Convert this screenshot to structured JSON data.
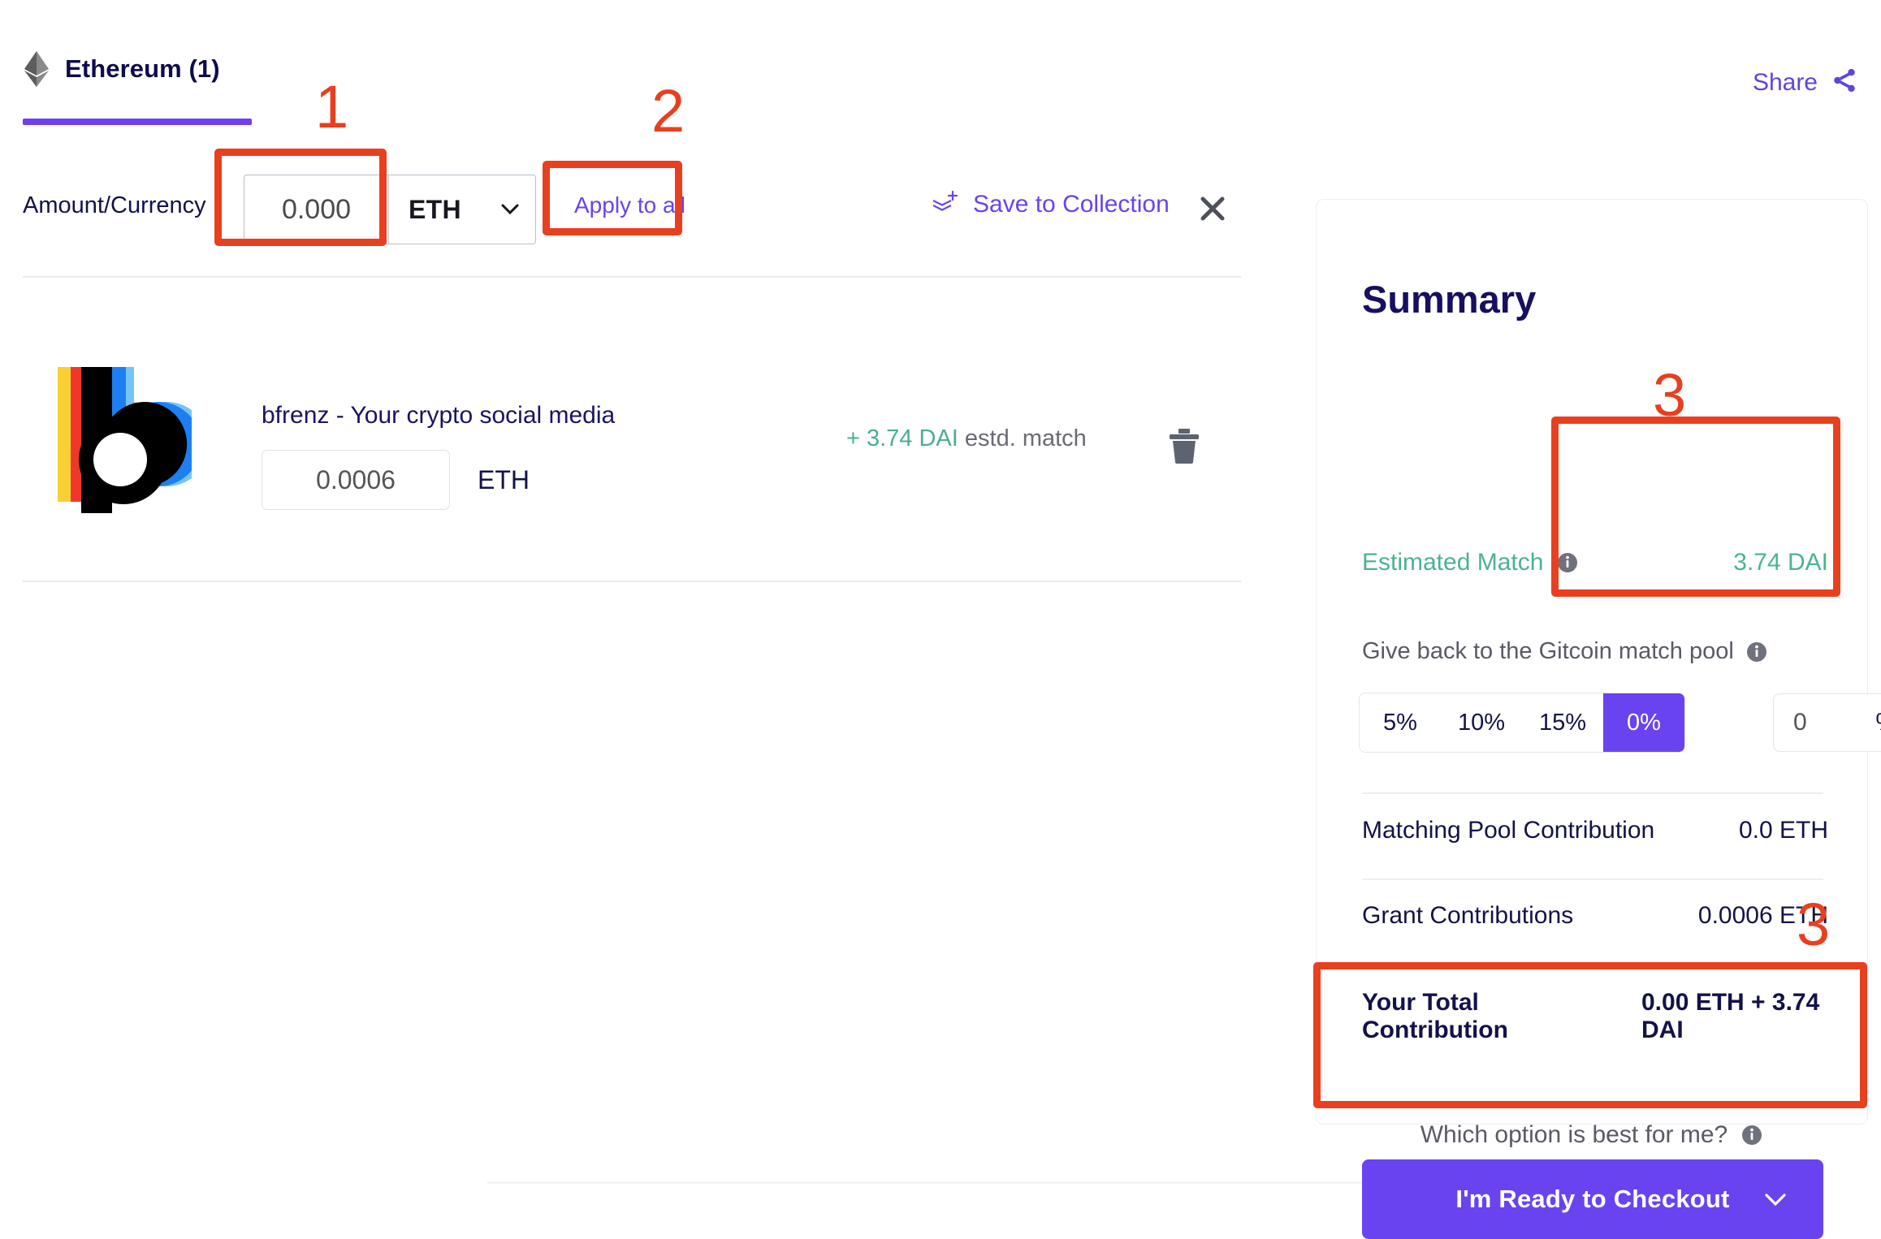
{
  "tab": {
    "label": "Ethereum (1)",
    "icon": "ethereum-icon"
  },
  "share": {
    "label": "Share",
    "icon": "share-icon"
  },
  "amount_row": {
    "label": "Amount/Currency",
    "amount_value": "0.000",
    "amount_placeholder": "0.000",
    "currency": "ETH",
    "apply_to_all": "Apply to all",
    "save_to_collection": "Save to Collection",
    "close_icon": "close-icon"
  },
  "grant": {
    "title": "bfrenz - Your crypto social media",
    "amount_value": "0.0006",
    "currency": "ETH",
    "match_prefix": "+ 3.74 DAI",
    "match_suffix": "estd. match",
    "delete_icon": "trash-icon",
    "logo_colors": [
      "#f8d035",
      "#ef3829",
      "#000000",
      "#1d7ff2",
      "#76c4f7"
    ]
  },
  "summary": {
    "title": "Summary",
    "estimated_match_label": "Estimated Match",
    "estimated_match_value": "3.74 DAI",
    "give_back_label": "Give back to the Gitcoin match pool",
    "percent_options": [
      "5%",
      "10%",
      "15%"
    ],
    "percent_selected": "0%",
    "percent_input_value": "0",
    "percent_symbol": "%",
    "rows": [
      {
        "label": "Matching Pool Contribution",
        "value": "0.0 ETH"
      },
      {
        "label": "Grant Contributions",
        "value": "0.0006 ETH"
      }
    ],
    "total_label": "Your Total Contribution",
    "total_value": "0.00 ETH + 3.74 DAI",
    "which_option": "Which option is best for me?",
    "checkout_label": "I'm Ready to Checkout",
    "checkout_chevron": "chevron-down-icon"
  },
  "annotations": {
    "one": "1",
    "two": "2",
    "three_a": "3",
    "three_b": "3",
    "color": "#e8401f"
  },
  "colors": {
    "purple": "#6943ef",
    "navy": "#13124a",
    "green": "#49b08a",
    "annotation_red": "#e8401f"
  }
}
